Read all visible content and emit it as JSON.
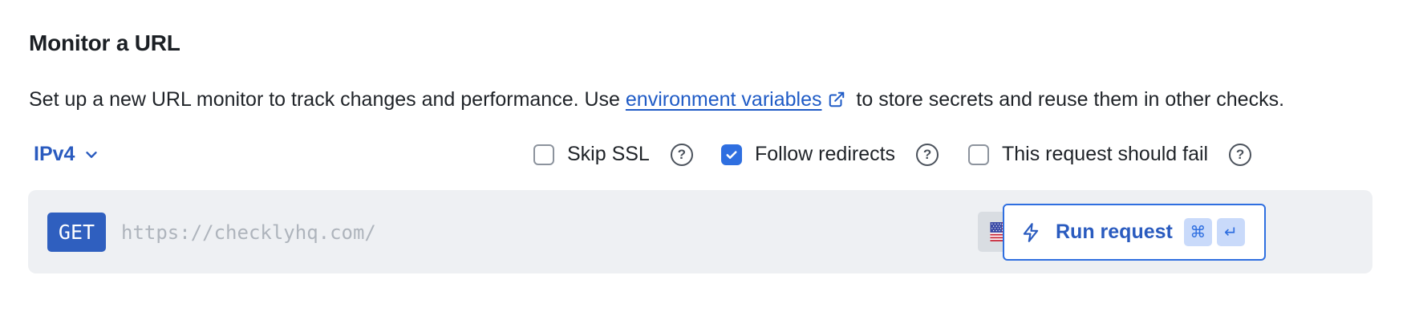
{
  "header": {
    "title": "Monitor a URL"
  },
  "description": {
    "prefix": "Set up a new URL monitor to track changes and performance. Use ",
    "link_text": "environment variables",
    "suffix": " to store secrets and reuse them in other checks."
  },
  "ip_version": {
    "selected": "IPv4"
  },
  "options": {
    "skip_ssl": {
      "label": "Skip SSL",
      "checked": false
    },
    "follow_redirects": {
      "label": "Follow redirects",
      "checked": true
    },
    "should_fail": {
      "label": "This request should fail",
      "checked": false
    },
    "help_glyph": "?"
  },
  "request": {
    "method": "GET",
    "url_value": "",
    "url_placeholder": "https://checklyhq.com/",
    "region_icon": "us-flag-icon",
    "run_label": "Run request",
    "shortcut_keys": [
      "⌘",
      "↵"
    ]
  },
  "colors": {
    "accent": "#2f6fe0",
    "link": "#1f5bc6",
    "method_bg": "#2f5fbf",
    "bar_bg": "#eef0f3"
  }
}
